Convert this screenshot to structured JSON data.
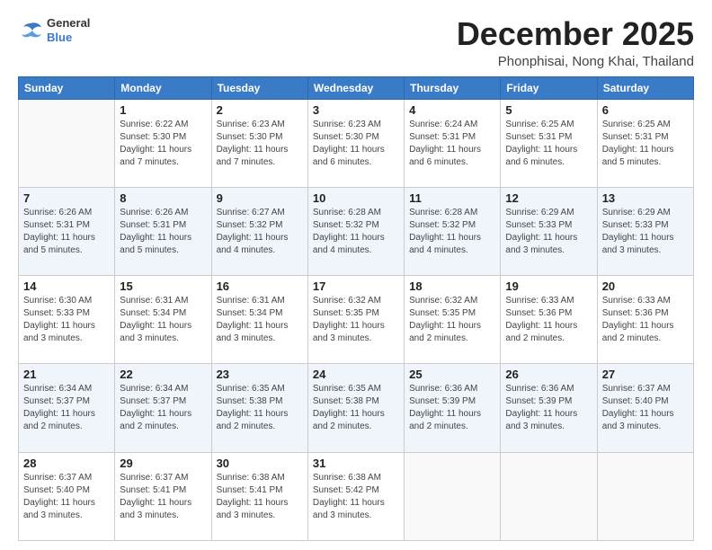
{
  "header": {
    "logo_general": "General",
    "logo_blue": "Blue",
    "month_title": "December 2025",
    "location": "Phonphisai, Nong Khai, Thailand"
  },
  "weekdays": [
    "Sunday",
    "Monday",
    "Tuesday",
    "Wednesday",
    "Thursday",
    "Friday",
    "Saturday"
  ],
  "weeks": [
    [
      {
        "day": "",
        "sunrise": "",
        "sunset": "",
        "daylight": ""
      },
      {
        "day": "1",
        "sunrise": "Sunrise: 6:22 AM",
        "sunset": "Sunset: 5:30 PM",
        "daylight": "Daylight: 11 hours and 7 minutes."
      },
      {
        "day": "2",
        "sunrise": "Sunrise: 6:23 AM",
        "sunset": "Sunset: 5:30 PM",
        "daylight": "Daylight: 11 hours and 7 minutes."
      },
      {
        "day": "3",
        "sunrise": "Sunrise: 6:23 AM",
        "sunset": "Sunset: 5:30 PM",
        "daylight": "Daylight: 11 hours and 6 minutes."
      },
      {
        "day": "4",
        "sunrise": "Sunrise: 6:24 AM",
        "sunset": "Sunset: 5:31 PM",
        "daylight": "Daylight: 11 hours and 6 minutes."
      },
      {
        "day": "5",
        "sunrise": "Sunrise: 6:25 AM",
        "sunset": "Sunset: 5:31 PM",
        "daylight": "Daylight: 11 hours and 6 minutes."
      },
      {
        "day": "6",
        "sunrise": "Sunrise: 6:25 AM",
        "sunset": "Sunset: 5:31 PM",
        "daylight": "Daylight: 11 hours and 5 minutes."
      }
    ],
    [
      {
        "day": "7",
        "sunrise": "Sunrise: 6:26 AM",
        "sunset": "Sunset: 5:31 PM",
        "daylight": "Daylight: 11 hours and 5 minutes."
      },
      {
        "day": "8",
        "sunrise": "Sunrise: 6:26 AM",
        "sunset": "Sunset: 5:31 PM",
        "daylight": "Daylight: 11 hours and 5 minutes."
      },
      {
        "day": "9",
        "sunrise": "Sunrise: 6:27 AM",
        "sunset": "Sunset: 5:32 PM",
        "daylight": "Daylight: 11 hours and 4 minutes."
      },
      {
        "day": "10",
        "sunrise": "Sunrise: 6:28 AM",
        "sunset": "Sunset: 5:32 PM",
        "daylight": "Daylight: 11 hours and 4 minutes."
      },
      {
        "day": "11",
        "sunrise": "Sunrise: 6:28 AM",
        "sunset": "Sunset: 5:32 PM",
        "daylight": "Daylight: 11 hours and 4 minutes."
      },
      {
        "day": "12",
        "sunrise": "Sunrise: 6:29 AM",
        "sunset": "Sunset: 5:33 PM",
        "daylight": "Daylight: 11 hours and 3 minutes."
      },
      {
        "day": "13",
        "sunrise": "Sunrise: 6:29 AM",
        "sunset": "Sunset: 5:33 PM",
        "daylight": "Daylight: 11 hours and 3 minutes."
      }
    ],
    [
      {
        "day": "14",
        "sunrise": "Sunrise: 6:30 AM",
        "sunset": "Sunset: 5:33 PM",
        "daylight": "Daylight: 11 hours and 3 minutes."
      },
      {
        "day": "15",
        "sunrise": "Sunrise: 6:31 AM",
        "sunset": "Sunset: 5:34 PM",
        "daylight": "Daylight: 11 hours and 3 minutes."
      },
      {
        "day": "16",
        "sunrise": "Sunrise: 6:31 AM",
        "sunset": "Sunset: 5:34 PM",
        "daylight": "Daylight: 11 hours and 3 minutes."
      },
      {
        "day": "17",
        "sunrise": "Sunrise: 6:32 AM",
        "sunset": "Sunset: 5:35 PM",
        "daylight": "Daylight: 11 hours and 3 minutes."
      },
      {
        "day": "18",
        "sunrise": "Sunrise: 6:32 AM",
        "sunset": "Sunset: 5:35 PM",
        "daylight": "Daylight: 11 hours and 2 minutes."
      },
      {
        "day": "19",
        "sunrise": "Sunrise: 6:33 AM",
        "sunset": "Sunset: 5:36 PM",
        "daylight": "Daylight: 11 hours and 2 minutes."
      },
      {
        "day": "20",
        "sunrise": "Sunrise: 6:33 AM",
        "sunset": "Sunset: 5:36 PM",
        "daylight": "Daylight: 11 hours and 2 minutes."
      }
    ],
    [
      {
        "day": "21",
        "sunrise": "Sunrise: 6:34 AM",
        "sunset": "Sunset: 5:37 PM",
        "daylight": "Daylight: 11 hours and 2 minutes."
      },
      {
        "day": "22",
        "sunrise": "Sunrise: 6:34 AM",
        "sunset": "Sunset: 5:37 PM",
        "daylight": "Daylight: 11 hours and 2 minutes."
      },
      {
        "day": "23",
        "sunrise": "Sunrise: 6:35 AM",
        "sunset": "Sunset: 5:38 PM",
        "daylight": "Daylight: 11 hours and 2 minutes."
      },
      {
        "day": "24",
        "sunrise": "Sunrise: 6:35 AM",
        "sunset": "Sunset: 5:38 PM",
        "daylight": "Daylight: 11 hours and 2 minutes."
      },
      {
        "day": "25",
        "sunrise": "Sunrise: 6:36 AM",
        "sunset": "Sunset: 5:39 PM",
        "daylight": "Daylight: 11 hours and 2 minutes."
      },
      {
        "day": "26",
        "sunrise": "Sunrise: 6:36 AM",
        "sunset": "Sunset: 5:39 PM",
        "daylight": "Daylight: 11 hours and 3 minutes."
      },
      {
        "day": "27",
        "sunrise": "Sunrise: 6:37 AM",
        "sunset": "Sunset: 5:40 PM",
        "daylight": "Daylight: 11 hours and 3 minutes."
      }
    ],
    [
      {
        "day": "28",
        "sunrise": "Sunrise: 6:37 AM",
        "sunset": "Sunset: 5:40 PM",
        "daylight": "Daylight: 11 hours and 3 minutes."
      },
      {
        "day": "29",
        "sunrise": "Sunrise: 6:37 AM",
        "sunset": "Sunset: 5:41 PM",
        "daylight": "Daylight: 11 hours and 3 minutes."
      },
      {
        "day": "30",
        "sunrise": "Sunrise: 6:38 AM",
        "sunset": "Sunset: 5:41 PM",
        "daylight": "Daylight: 11 hours and 3 minutes."
      },
      {
        "day": "31",
        "sunrise": "Sunrise: 6:38 AM",
        "sunset": "Sunset: 5:42 PM",
        "daylight": "Daylight: 11 hours and 3 minutes."
      },
      {
        "day": "",
        "sunrise": "",
        "sunset": "",
        "daylight": ""
      },
      {
        "day": "",
        "sunrise": "",
        "sunset": "",
        "daylight": ""
      },
      {
        "day": "",
        "sunrise": "",
        "sunset": "",
        "daylight": ""
      }
    ]
  ]
}
